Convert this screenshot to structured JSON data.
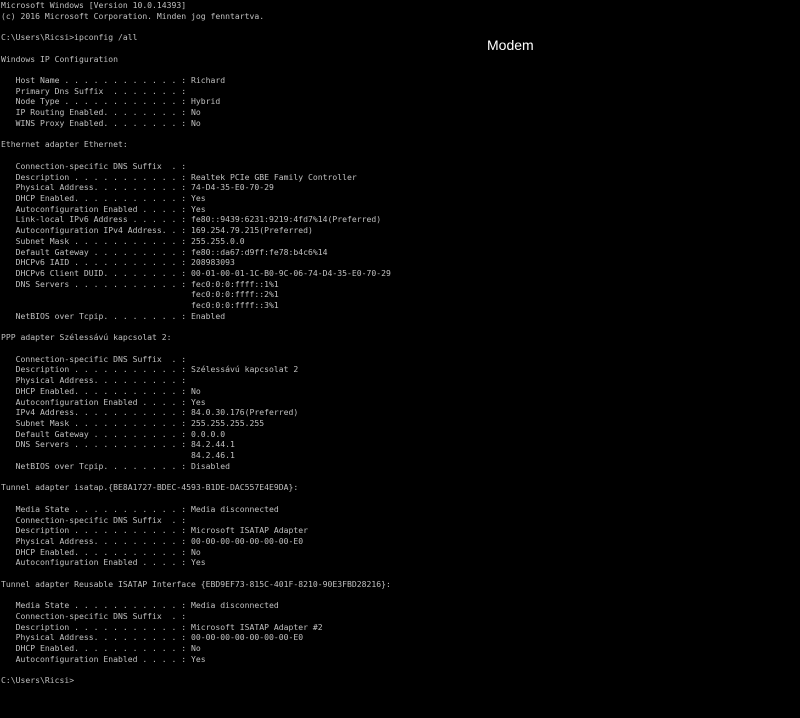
{
  "colors": {
    "background": "#000000",
    "console_text": "#c0c0c0",
    "overlay_text": "#ffffff"
  },
  "overlay_label": "Modem",
  "console_lines": [
    "Microsoft Windows [Version 10.0.14393]",
    "(c) 2016 Microsoft Corporation. Minden jog fenntartva.",
    "",
    "C:\\Users\\Ricsi>ipconfig /all",
    "",
    "Windows IP Configuration",
    "",
    "   Host Name . . . . . . . . . . . . : Richard",
    "   Primary Dns Suffix  . . . . . . . :",
    "   Node Type . . . . . . . . . . . . : Hybrid",
    "   IP Routing Enabled. . . . . . . . : No",
    "   WINS Proxy Enabled. . . . . . . . : No",
    "",
    "Ethernet adapter Ethernet:",
    "",
    "   Connection-specific DNS Suffix  . :",
    "   Description . . . . . . . . . . . : Realtek PCIe GBE Family Controller",
    "   Physical Address. . . . . . . . . : 74-D4-35-E0-70-29",
    "   DHCP Enabled. . . . . . . . . . . : Yes",
    "   Autoconfiguration Enabled . . . . : Yes",
    "   Link-local IPv6 Address . . . . . : fe80::9439:6231:9219:4fd7%14(Preferred)",
    "   Autoconfiguration IPv4 Address. . : 169.254.79.215(Preferred)",
    "   Subnet Mask . . . . . . . . . . . : 255.255.0.0",
    "   Default Gateway . . . . . . . . . : fe80::da67:d9ff:fe78:b4c6%14",
    "   DHCPv6 IAID . . . . . . . . . . . : 208983093",
    "   DHCPv6 Client DUID. . . . . . . . : 00-01-00-01-1C-B0-9C-06-74-D4-35-E0-70-29",
    "   DNS Servers . . . . . . . . . . . : fec0:0:0:ffff::1%1",
    "                                       fec0:0:0:ffff::2%1",
    "                                       fec0:0:0:ffff::3%1",
    "   NetBIOS over Tcpip. . . . . . . . : Enabled",
    "",
    "PPP adapter Szélessávú kapcsolat 2:",
    "",
    "   Connection-specific DNS Suffix  . :",
    "   Description . . . . . . . . . . . : Szélessávú kapcsolat 2",
    "   Physical Address. . . . . . . . . :",
    "   DHCP Enabled. . . . . . . . . . . : No",
    "   Autoconfiguration Enabled . . . . : Yes",
    "   IPv4 Address. . . . . . . . . . . : 84.0.30.176(Preferred)",
    "   Subnet Mask . . . . . . . . . . . : 255.255.255.255",
    "   Default Gateway . . . . . . . . . : 0.0.0.0",
    "   DNS Servers . . . . . . . . . . . : 84.2.44.1",
    "                                       84.2.46.1",
    "   NetBIOS over Tcpip. . . . . . . . : Disabled",
    "",
    "Tunnel adapter isatap.{BE8A1727-BDEC-4593-B1DE-DAC557E4E9DA}:",
    "",
    "   Media State . . . . . . . . . . . : Media disconnected",
    "   Connection-specific DNS Suffix  . :",
    "   Description . . . . . . . . . . . : Microsoft ISATAP Adapter",
    "   Physical Address. . . . . . . . . : 00-00-00-00-00-00-00-E0",
    "   DHCP Enabled. . . . . . . . . . . : No",
    "   Autoconfiguration Enabled . . . . : Yes",
    "",
    "Tunnel adapter Reusable ISATAP Interface {EBD9EF73-815C-401F-8210-90E3FBD28216}:",
    "",
    "   Media State . . . . . . . . . . . : Media disconnected",
    "   Connection-specific DNS Suffix  . :",
    "   Description . . . . . . . . . . . : Microsoft ISATAP Adapter #2",
    "   Physical Address. . . . . . . . . : 00-00-00-00-00-00-00-E0",
    "   DHCP Enabled. . . . . . . . . . . : No",
    "   Autoconfiguration Enabled . . . . : Yes",
    "",
    "C:\\Users\\Ricsi>"
  ]
}
